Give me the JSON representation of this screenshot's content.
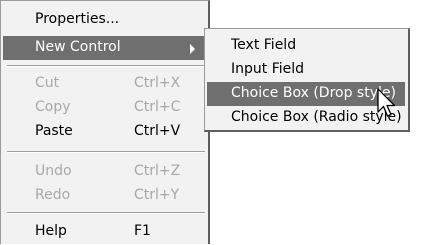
{
  "context_menu": {
    "items": [
      {
        "label": "Properties...",
        "accelerator": "",
        "enabled": true
      },
      {
        "label": "New Control",
        "accelerator": "",
        "enabled": true,
        "submenu": true,
        "highlighted": true
      },
      {
        "label": "Cut",
        "accelerator": "Ctrl+X",
        "enabled": false
      },
      {
        "label": "Copy",
        "accelerator": "Ctrl+C",
        "enabled": false
      },
      {
        "label": "Paste",
        "accelerator": "Ctrl+V",
        "enabled": true
      },
      {
        "label": "Undo",
        "accelerator": "Ctrl+Z",
        "enabled": false
      },
      {
        "label": "Redo",
        "accelerator": "Ctrl+Y",
        "enabled": false
      },
      {
        "label": "Help",
        "accelerator": "F1",
        "enabled": true
      }
    ]
  },
  "submenu": {
    "items": [
      {
        "label": "Text Field"
      },
      {
        "label": "Input Field"
      },
      {
        "label": "Choice Box (Drop style)",
        "highlighted": true
      },
      {
        "label": "Choice Box (Radio style)"
      }
    ]
  },
  "colors": {
    "menu_background": "#f2f2f2",
    "highlight": "#6f6f6f",
    "disabled_text": "#a8a8a8"
  },
  "icons": {
    "submenu_arrow": "chevron-right-icon",
    "cursor": "mouse-pointer-icon"
  }
}
